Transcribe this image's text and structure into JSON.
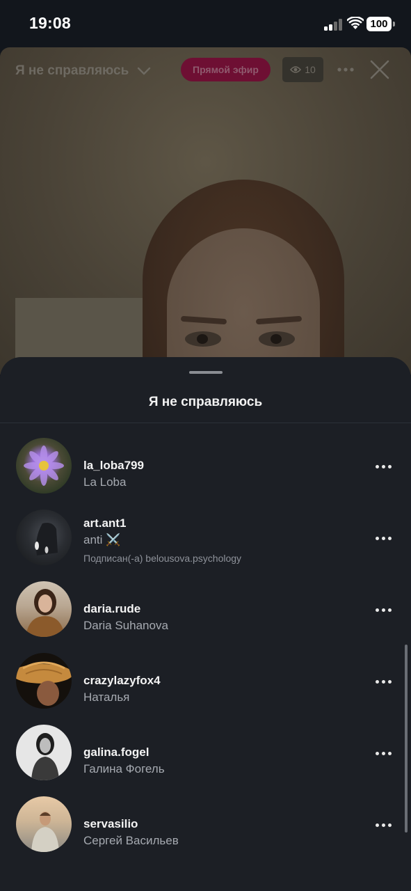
{
  "status": {
    "time": "19:08",
    "battery": "100"
  },
  "live": {
    "title": "Я не справляюсь",
    "badge": "Прямой эфир",
    "viewers": "10"
  },
  "sheet": {
    "title": "Я не справляюсь",
    "users": [
      {
        "username": "la_loba799",
        "name": "La Loba",
        "avatar": "purple-lotus"
      },
      {
        "username": "art.ant1",
        "name": "anti ⚔️",
        "followed": "Подписан(-а) belousova.psychology",
        "avatar": "dark-figure"
      },
      {
        "username": "daria.rude",
        "name": "Daria Suhanova",
        "avatar": "woman-brown"
      },
      {
        "username": "crazylazyfox4",
        "name": "Наталья",
        "avatar": "straw-hat"
      },
      {
        "username": "galina.fogel",
        "name": "Галина Фогель",
        "avatar": "woman-bw"
      },
      {
        "username": "servasilio",
        "name": "Сергей Васильев",
        "avatar": "man-beach"
      }
    ]
  }
}
